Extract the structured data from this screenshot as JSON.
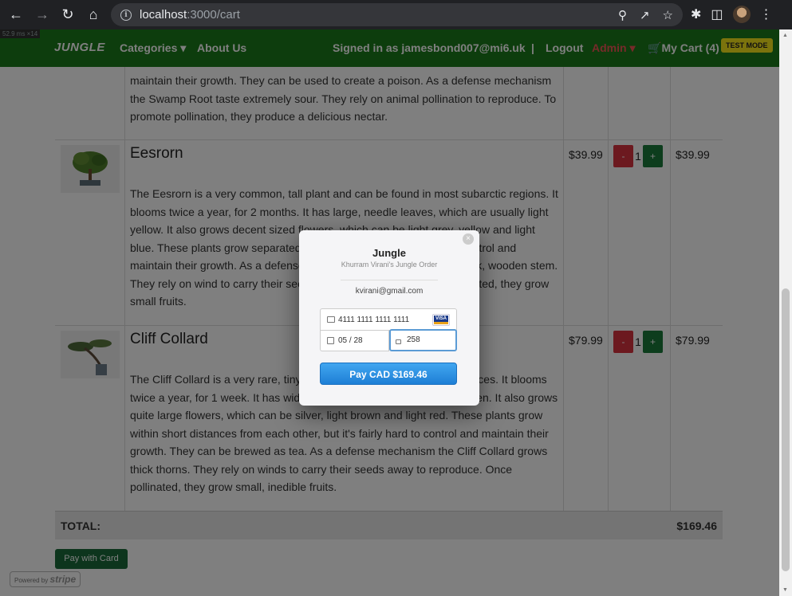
{
  "browser": {
    "url_host": "localhost",
    "url_path": ":3000/cart"
  },
  "perf_badge": "52.9 ms ×14",
  "navbar": {
    "brand": "JUNGLE",
    "categories": "Categories",
    "about": "About Us",
    "signed_in": "Signed in as jamesbond007@mi6.uk",
    "separator": "|",
    "logout": "Logout",
    "admin": "Admin",
    "cart": "My Cart (4)",
    "test_mode": "TEST MODE"
  },
  "cart": {
    "rows": [
      {
        "title": "",
        "description": "maintain their growth. They can be used to create a poison. As a defense mechanism the Swamp Root taste extremely sour. They rely on animal pollination to reproduce. To promote pollination, they produce a delicious nectar.",
        "price": "",
        "qty": "",
        "subtotal": ""
      },
      {
        "title": "Eesrorn",
        "description": "The Eesrorn is a very common, tall plant and can be found in most subarctic regions. It blooms twice a year, for 2 months. It has large, needle leaves, which are usually light yellow. It also grows decent sized flowers, which can be light grey, yellow and light blue. These plants grow separated from each other, but it's hard to control and maintain their growth. As a defense mechanism the Eesrorn has a thick, wooden stem. They rely on wind to carry their seeds away to reproduce. Once pollinated, they grow small fruits.",
        "price": "$39.99",
        "qty": "1",
        "minus": "-",
        "plus": "+",
        "subtotal": "$39.99"
      },
      {
        "title": "Cliff Collard",
        "description": "The Cliff Collard is a very rare, tiny plant and can be found in some places. It blooms twice a year, for 1 week. It has wide leaves, which are usually lime green. It also grows quite large flowers, which can be silver, light brown and light red. These plants grow within short distances from each other, but it's fairly hard to control and maintain their growth. They can be brewed as tea. As a defense mechanism the Cliff Collard grows thick thorns. They rely on winds to carry their seeds away to reproduce. Once pollinated, they grow small, inedible fruits.",
        "price": "$79.99",
        "qty": "1",
        "minus": "-",
        "plus": "+",
        "subtotal": "$79.99"
      }
    ],
    "total_label": "TOTAL:",
    "total_value": "$169.46",
    "pay_with_card": "Pay with Card",
    "powered_by": "Powered by",
    "stripe": "stripe"
  },
  "checkout_modal": {
    "close": "×",
    "title": "Jungle",
    "subtitle": "Khurram Virani's Jungle Order",
    "email": "kvirani@gmail.com",
    "card_number": "4111 1111 1111 1111",
    "card_brand": "VISA",
    "expiry": "05 / 28",
    "cvc": "258",
    "pay_button": "Pay CAD $169.46"
  }
}
